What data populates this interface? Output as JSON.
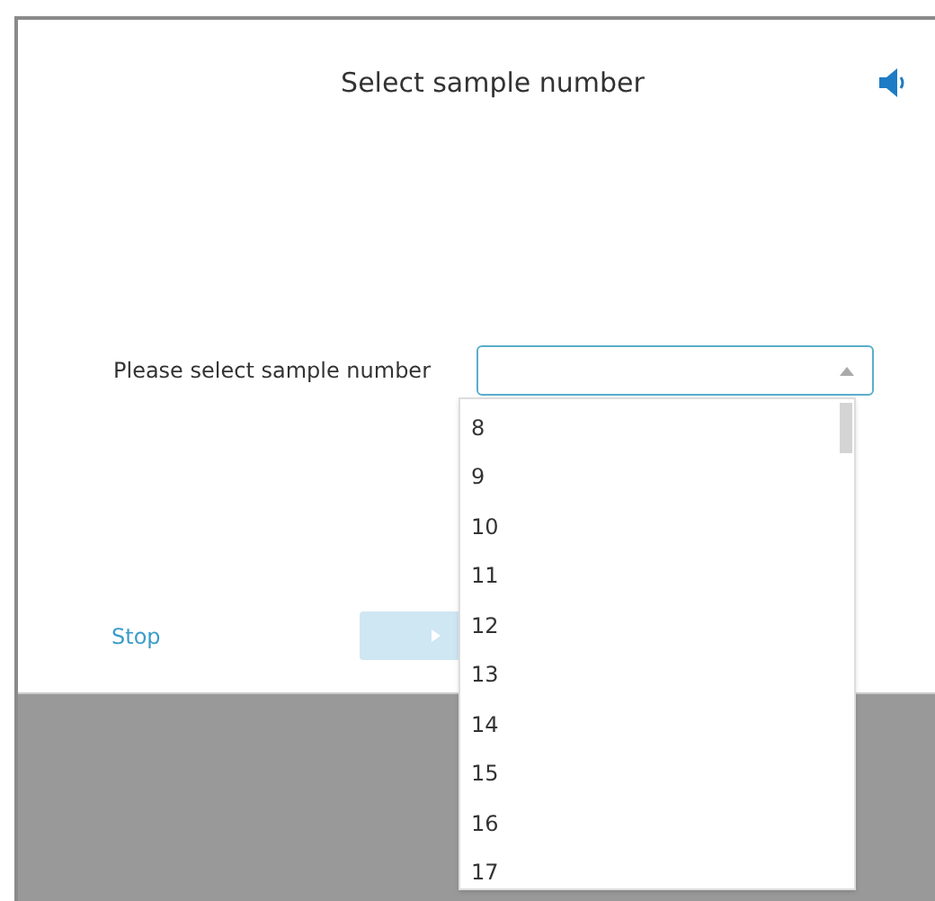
{
  "dialog": {
    "title": "Select sample number"
  },
  "field": {
    "label": "Please select sample number",
    "expanded": true
  },
  "options": [
    {
      "label": "8"
    },
    {
      "label": "9"
    },
    {
      "label": "10"
    },
    {
      "label": "11"
    },
    {
      "label": "12"
    },
    {
      "label": "13"
    },
    {
      "label": "14"
    },
    {
      "label": "15"
    },
    {
      "label": "16"
    },
    {
      "label": "17"
    }
  ],
  "stop": {
    "label": "Stop"
  },
  "continue": {
    "disabled": true
  }
}
